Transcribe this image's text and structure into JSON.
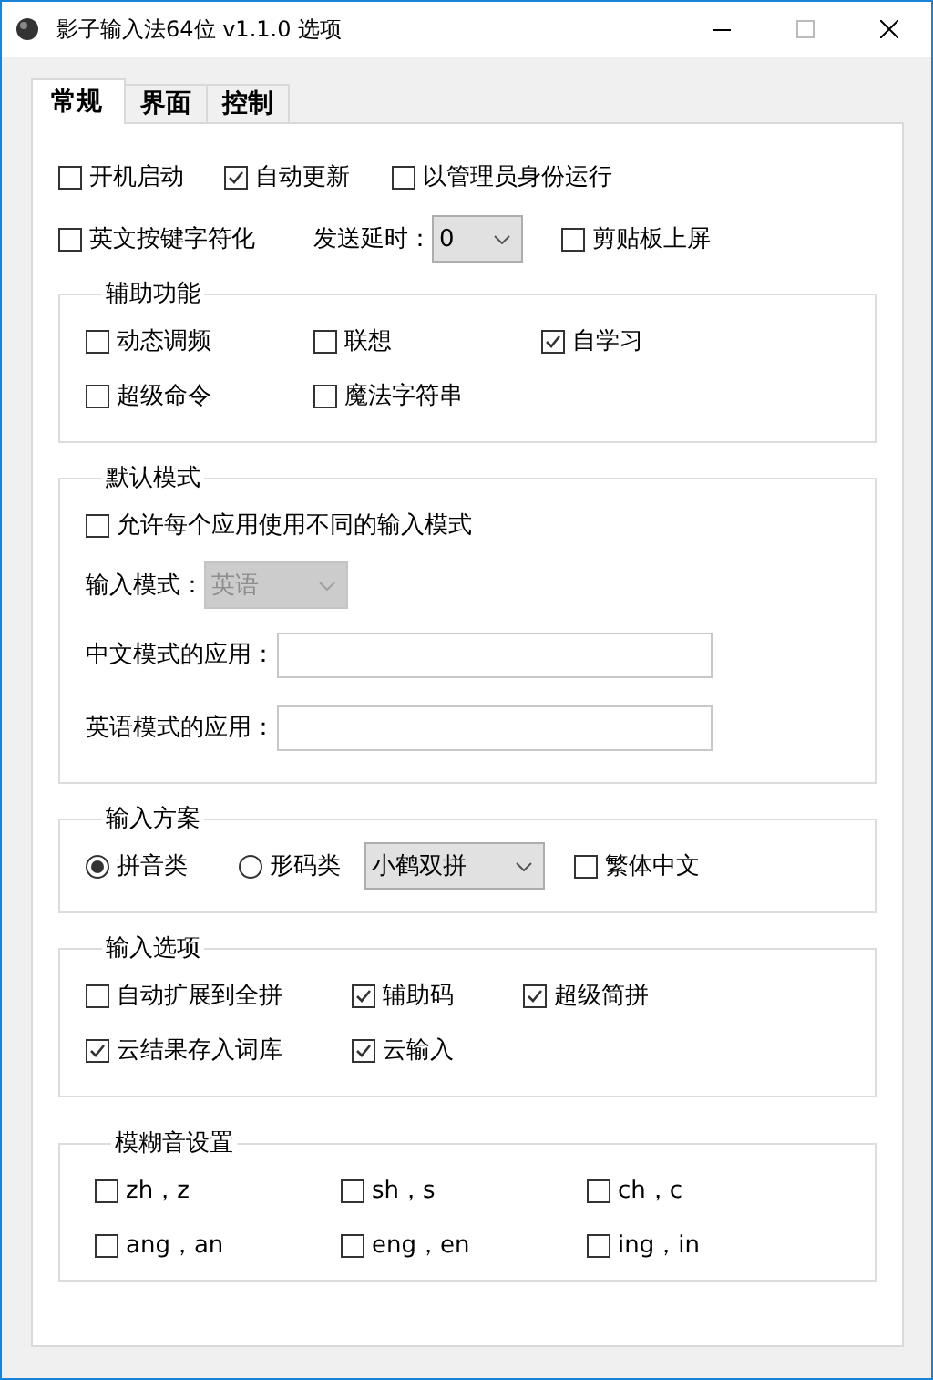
{
  "window": {
    "title": "影子输入法64位 v1.1.0 选项"
  },
  "tabs": [
    {
      "label": "常规",
      "selected": true
    },
    {
      "label": "界面",
      "selected": false
    },
    {
      "label": "控制",
      "selected": false
    }
  ],
  "general": [
    [
      {
        "kind": "checkbox",
        "label": "开机启动",
        "checked": false
      },
      {
        "kind": "checkbox",
        "label": "自动更新",
        "checked": true
      },
      {
        "kind": "checkbox",
        "label": "以管理员身份运行",
        "checked": false
      }
    ],
    [
      {
        "kind": "checkbox",
        "label": "英文按键字符化",
        "checked": false
      },
      {
        "kind": "select",
        "label": "发送延时：",
        "value": "0",
        "disabled": false
      },
      {
        "kind": "checkbox",
        "label": "剪贴板上屏",
        "checked": false
      }
    ]
  ],
  "groups": [
    {
      "title": "辅助功能",
      "rows": [
        [
          {
            "kind": "checkbox",
            "label": "动态调频",
            "checked": false
          },
          {
            "kind": "checkbox",
            "label": "联想",
            "checked": false
          },
          {
            "kind": "checkbox",
            "label": "自学习",
            "checked": true
          }
        ],
        [
          {
            "kind": "checkbox",
            "label": "超级命令",
            "checked": false
          },
          {
            "kind": "checkbox",
            "label": "魔法字符串",
            "checked": false
          }
        ]
      ]
    },
    {
      "title": "默认模式",
      "rows": [
        [
          {
            "kind": "checkbox",
            "label": "允许每个应用使用不同的输入模式",
            "checked": false
          }
        ],
        [
          {
            "kind": "select",
            "label": "输入模式：",
            "value": "英语",
            "disabled": true
          }
        ],
        [
          {
            "kind": "text",
            "label": "中文模式的应用："
          }
        ],
        [
          {
            "kind": "text",
            "label": "英语模式的应用："
          }
        ]
      ]
    },
    {
      "title": "输入方案",
      "rows": [
        [
          {
            "kind": "radio",
            "label": "拼音类",
            "selected": true
          },
          {
            "kind": "radio",
            "label": "形码类",
            "selected": false
          },
          {
            "kind": "select",
            "value": "小鹤双拼",
            "disabled": false
          },
          {
            "kind": "checkbox",
            "label": "繁体中文",
            "checked": false
          }
        ]
      ]
    },
    {
      "title": "输入选项",
      "rows": [
        [
          {
            "kind": "checkbox",
            "label": "自动扩展到全拼",
            "checked": false
          },
          {
            "kind": "checkbox",
            "label": "辅助码",
            "checked": true
          },
          {
            "kind": "checkbox",
            "label": "超级简拼",
            "checked": true
          }
        ],
        [
          {
            "kind": "checkbox",
            "label": "云结果存入词库",
            "checked": true
          },
          {
            "kind": "checkbox",
            "label": "云输入",
            "checked": true
          }
        ]
      ]
    },
    {
      "title": "模糊音设置",
      "rows": [
        [
          {
            "kind": "checkbox",
            "label": "zh，z",
            "checked": false
          },
          {
            "kind": "checkbox",
            "label": "sh，s",
            "checked": false
          },
          {
            "kind": "checkbox",
            "label": "ch，c",
            "checked": false
          }
        ],
        [
          {
            "kind": "checkbox",
            "label": "ang，an",
            "checked": false
          },
          {
            "kind": "checkbox",
            "label": "eng，en",
            "checked": false
          },
          {
            "kind": "checkbox",
            "label": "ing，in",
            "checked": false
          }
        ]
      ]
    }
  ]
}
